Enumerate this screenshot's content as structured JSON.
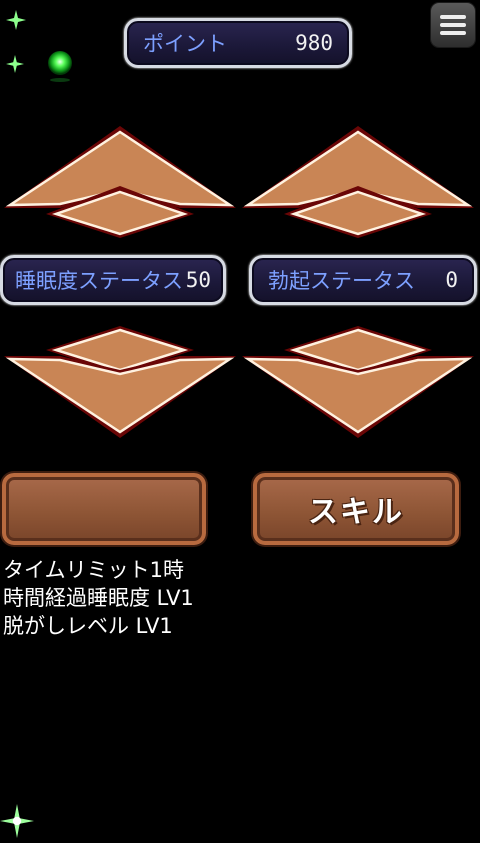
{
  "points": {
    "label": "ポイント",
    "value": "980"
  },
  "sleep_status": {
    "label": "睡眠度ステータス",
    "value": "50"
  },
  "arousal_status": {
    "label": "勃起ステータス",
    "value": "0"
  },
  "buttons": {
    "empty_label": "",
    "skill_label": "スキル"
  },
  "info_lines": {
    "line1": "タイムリミット1時",
    "line2": "時間経過睡眠度 LV1",
    "line3": "脱がしレベル LV1"
  },
  "icons": {
    "menu": "hamburger-menu-icon",
    "up_arrow": "up-arrow-icon",
    "down_arrow": "down-arrow-icon",
    "sparkle": "sparkle-icon",
    "orb": "green-orb-icon"
  },
  "colors": {
    "background": "#000000",
    "panel_label": "#7da0ff",
    "arrow_fill": "#c98555",
    "arrow_border": "#7a0a0a",
    "button_fill": "#8f5636",
    "sparkle": "#8dff8d"
  }
}
